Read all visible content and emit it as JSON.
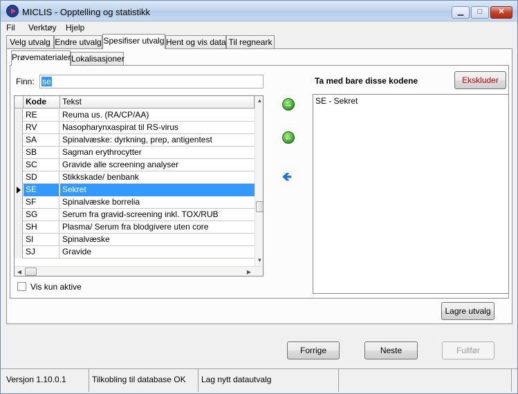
{
  "window": {
    "title": "MICLIS - Opptelling og statistikk",
    "min_symbol": "▁",
    "max_symbol": "□",
    "close_symbol": "✕"
  },
  "menu": [
    "Fil",
    "Verktøy",
    "Hjelp"
  ],
  "outer_tabs": [
    {
      "label": "Velg utvalg",
      "active": false
    },
    {
      "label": "Endre utvalg",
      "active": false
    },
    {
      "label": "Spesifiser utvalg",
      "active": true
    },
    {
      "label": "Hent og vis data",
      "active": false
    },
    {
      "label": "Til regneark",
      "active": false
    }
  ],
  "inner_tabs": [
    {
      "label": "Prøvematerialer",
      "active": true
    },
    {
      "label": "Lokalisasjoner",
      "active": false
    }
  ],
  "search": {
    "label": "Finn:",
    "value": "se"
  },
  "table": {
    "columns": [
      "Kode",
      "Tekst"
    ],
    "rows": [
      {
        "kode": "RE",
        "tekst": "Reuma us. (RA/CP/AA)"
      },
      {
        "kode": "RV",
        "tekst": "Nasopharynxaspirat til RS-virus"
      },
      {
        "kode": "SA",
        "tekst": "Spinalvæske: dyrkning, prep, antigentest"
      },
      {
        "kode": "SB",
        "tekst": "Sagman erythrocytter"
      },
      {
        "kode": "SC",
        "tekst": "Gravide alle screening analyser"
      },
      {
        "kode": "SD",
        "tekst": "Stikkskade/ benbank"
      },
      {
        "kode": "SE",
        "tekst": "Sekret",
        "selected": true
      },
      {
        "kode": "SF",
        "tekst": "Spinalvæske borrelia"
      },
      {
        "kode": "SG",
        "tekst": "Serum fra gravid-screening inkl. TOX/RUB"
      },
      {
        "kode": "SH",
        "tekst": "Plasma/ Serum fra blodgivere uten core"
      },
      {
        "kode": "SI",
        "tekst": "Spinalvæske"
      },
      {
        "kode": "SJ",
        "tekst": "Gravide"
      }
    ]
  },
  "vis_kun_aktive": {
    "label": "Vis kun aktive",
    "checked": false
  },
  "right": {
    "header": "Ta med bare disse kodene",
    "ekskluder_label": "Ekskluder",
    "items": [
      "SE - Sekret"
    ]
  },
  "icons": {
    "add": "→",
    "remove": "←",
    "move_left": "🡸"
  },
  "buttons": {
    "lagre": "Lagre utvalg",
    "forrige": "Forrige",
    "neste": "Neste",
    "fullfor": "Fullfør"
  },
  "status": [
    "Versjon 1.10.0.1",
    "Tilkobling til database OK",
    "Lag nytt datautvalg",
    ""
  ],
  "colors": {
    "selection": "#3399ff",
    "ekskluder_text": "#c00000"
  }
}
